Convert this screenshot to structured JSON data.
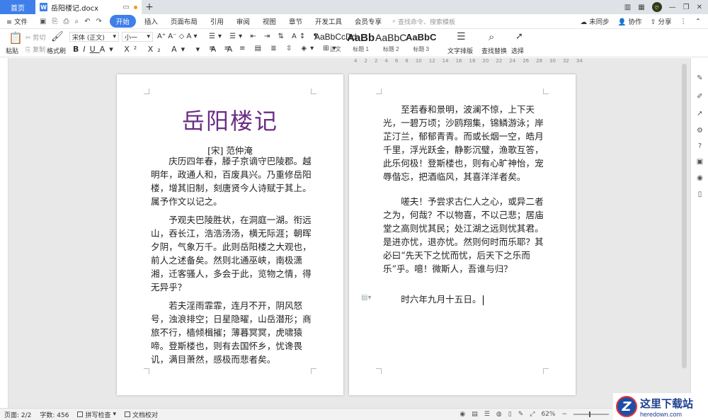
{
  "tabs": {
    "home": "首页",
    "doc": "岳阳楼记.docx"
  },
  "menu": {
    "file": "文件",
    "items": [
      "开始",
      "插入",
      "页面布局",
      "引用",
      "审阅",
      "视图",
      "章节",
      "开发工具",
      "会员专享"
    ],
    "search": "查找命令、搜索模板",
    "sync": "未同步",
    "collab": "协作",
    "share": "分享"
  },
  "ribbon": {
    "paste": "粘贴",
    "cut": "剪切",
    "copy": "复制",
    "format_painter": "格式刷",
    "font": "宋体 (正文)",
    "size": "小一",
    "styles": [
      {
        "sample": "AaBbCcDd",
        "label": "正文"
      },
      {
        "sample": "AaBb",
        "label": "标题 1"
      },
      {
        "sample": "AaBbC",
        "label": "标题 2"
      },
      {
        "sample": "AaBbC",
        "label": "标题 3"
      }
    ],
    "text_layout": "文字排版",
    "find_replace": "查找替换",
    "select": "选择"
  },
  "ruler": [
    "4",
    "2",
    "2",
    "4",
    "6",
    "8",
    "10",
    "12",
    "14",
    "16",
    "18",
    "20",
    "22",
    "24",
    "26",
    "28",
    "30",
    "32",
    "34"
  ],
  "doc": {
    "title": "岳阳楼记",
    "author": "[宋] 范仲淹",
    "p1": "庆历四年春，滕子京谪守巴陵郡。越明年，政通人和，百废具兴。乃重修岳阳楼，增其旧制，刻唐贤今人诗赋于其上。属予作文以记之。",
    "p2": "予观夫巴陵胜状，在洞庭一湖。衔远山，吞长江，浩浩汤汤，横无际涯；朝晖夕阴，气象万千。此则岳阳楼之大观也，前人之述备矣。然则北通巫峡，南极潇湘，迁客骚人，多会于此，览物之情，得无异乎？",
    "p3": "若夫淫雨霏霏，连月不开，阴风怒号，浊浪排空；日星隐曜，山岳潜形；商旅不行，樯倾楫摧；薄暮冥冥，虎啸猿啼。登斯楼也，则有去国怀乡，忧谗畏讥，满目萧然，感极而悲者矣。",
    "p4": "至若春和景明，波澜不惊，上下天光，一碧万顷；沙鸥翔集，锦鳞游泳；岸芷汀兰，郁郁青青。而或长烟一空，皓月千里，浮光跃金，静影沉璧，渔歌互答，此乐何极！登斯楼也，则有心旷神怡，宠辱偕忘，把酒临风，其喜洋洋者矣。",
    "p5": "嗟夫！予尝求古仁人之心，或异二者之为，何哉？不以物喜，不以己悲；居庙堂之高则忧其民；处江湖之远则忧其君。是进亦忧，退亦忧。然则何时而乐耶？其必曰“先天下之忧而忧，后天下之乐而乐”乎。噫！微斯人，吾谁与归？",
    "p6": "时六年九月十五日。"
  },
  "status": {
    "page": "页面: 2/2",
    "words": "字数: 456",
    "spell": "拼写检查",
    "proof": "文档校对",
    "zoom": "62%"
  },
  "logo": {
    "text": "这里下载站",
    "url": "heredown.com"
  },
  "colors": {
    "accent": "#3f7fe9",
    "title": "#6a2d86"
  }
}
